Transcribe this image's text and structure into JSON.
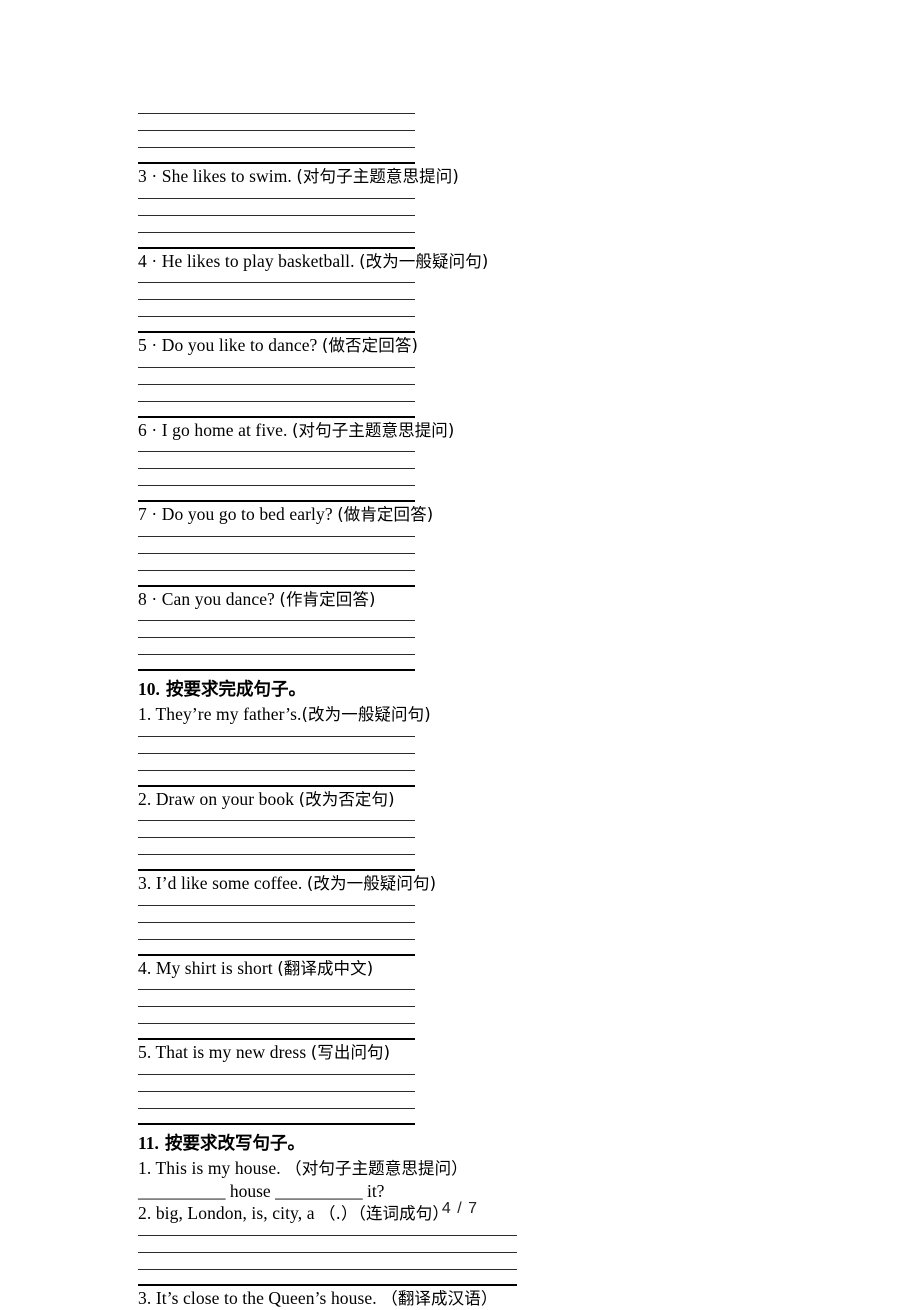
{
  "page": {
    "footer": "4 / 7"
  },
  "top_lines": {
    "count": 3
  },
  "items_continued": [
    {
      "num": "3",
      "sep": "·",
      "en": "She likes to swim.",
      "cn": "(对句子主题意思提问)",
      "lines": 3
    },
    {
      "num": "4",
      "sep": "·",
      "en": "He likes to play basketball.",
      "cn": "(改为一般疑问句)",
      "lines": 3
    },
    {
      "num": "5",
      "sep": "·",
      "en": "Do you like to dance?",
      "cn": "(做否定回答)",
      "lines": 3
    },
    {
      "num": "6",
      "sep": "·",
      "en": "I go home at five.",
      "cn": "(对句子主题意思提问)",
      "lines": 3
    },
    {
      "num": "7",
      "sep": "·",
      "en": "Do you go to bed early?",
      "cn": "(做肯定回答)",
      "lines": 3
    },
    {
      "num": "8",
      "sep": "·",
      "en": "Can you dance?",
      "cn": "(作肯定回答)",
      "lines": 3
    }
  ],
  "section10": {
    "number": "10.",
    "title": "按要求完成句子。",
    "items": [
      {
        "num": "1.",
        "en": "They’re my father’s.",
        "cn": "(改为一般疑问句)",
        "lines": 3
      },
      {
        "num": "2.",
        "en": "Draw on your book",
        "cn": "(改为否定句)",
        "lines": 3
      },
      {
        "num": "3.",
        "en": "I’d like some coffee.",
        "cn": "(改为一般疑问句)",
        "lines": 3
      },
      {
        "num": "4.",
        "en": "My shirt is short",
        "cn": "(翻译成中文)",
        "lines": 3
      },
      {
        "num": "5.",
        "en": "That is my new dress",
        "cn": "(写出问句)",
        "lines": 3
      }
    ]
  },
  "section11": {
    "number": "11.",
    "title": "按要求改写句子。",
    "items": [
      {
        "num": "1.",
        "en": "This is my house.",
        "cn": "（对句子主题意思提问）",
        "answer_template": "__________ house __________ it?",
        "lines": 0
      },
      {
        "num": "2.",
        "en": "big, London, is, city, a",
        "cn": "（.）（连词成句）",
        "lines": 3
      },
      {
        "num": "3.",
        "en": "It’s close to the Queen’s house.",
        "cn": "（翻译成汉语）",
        "lines": 0
      }
    ]
  }
}
